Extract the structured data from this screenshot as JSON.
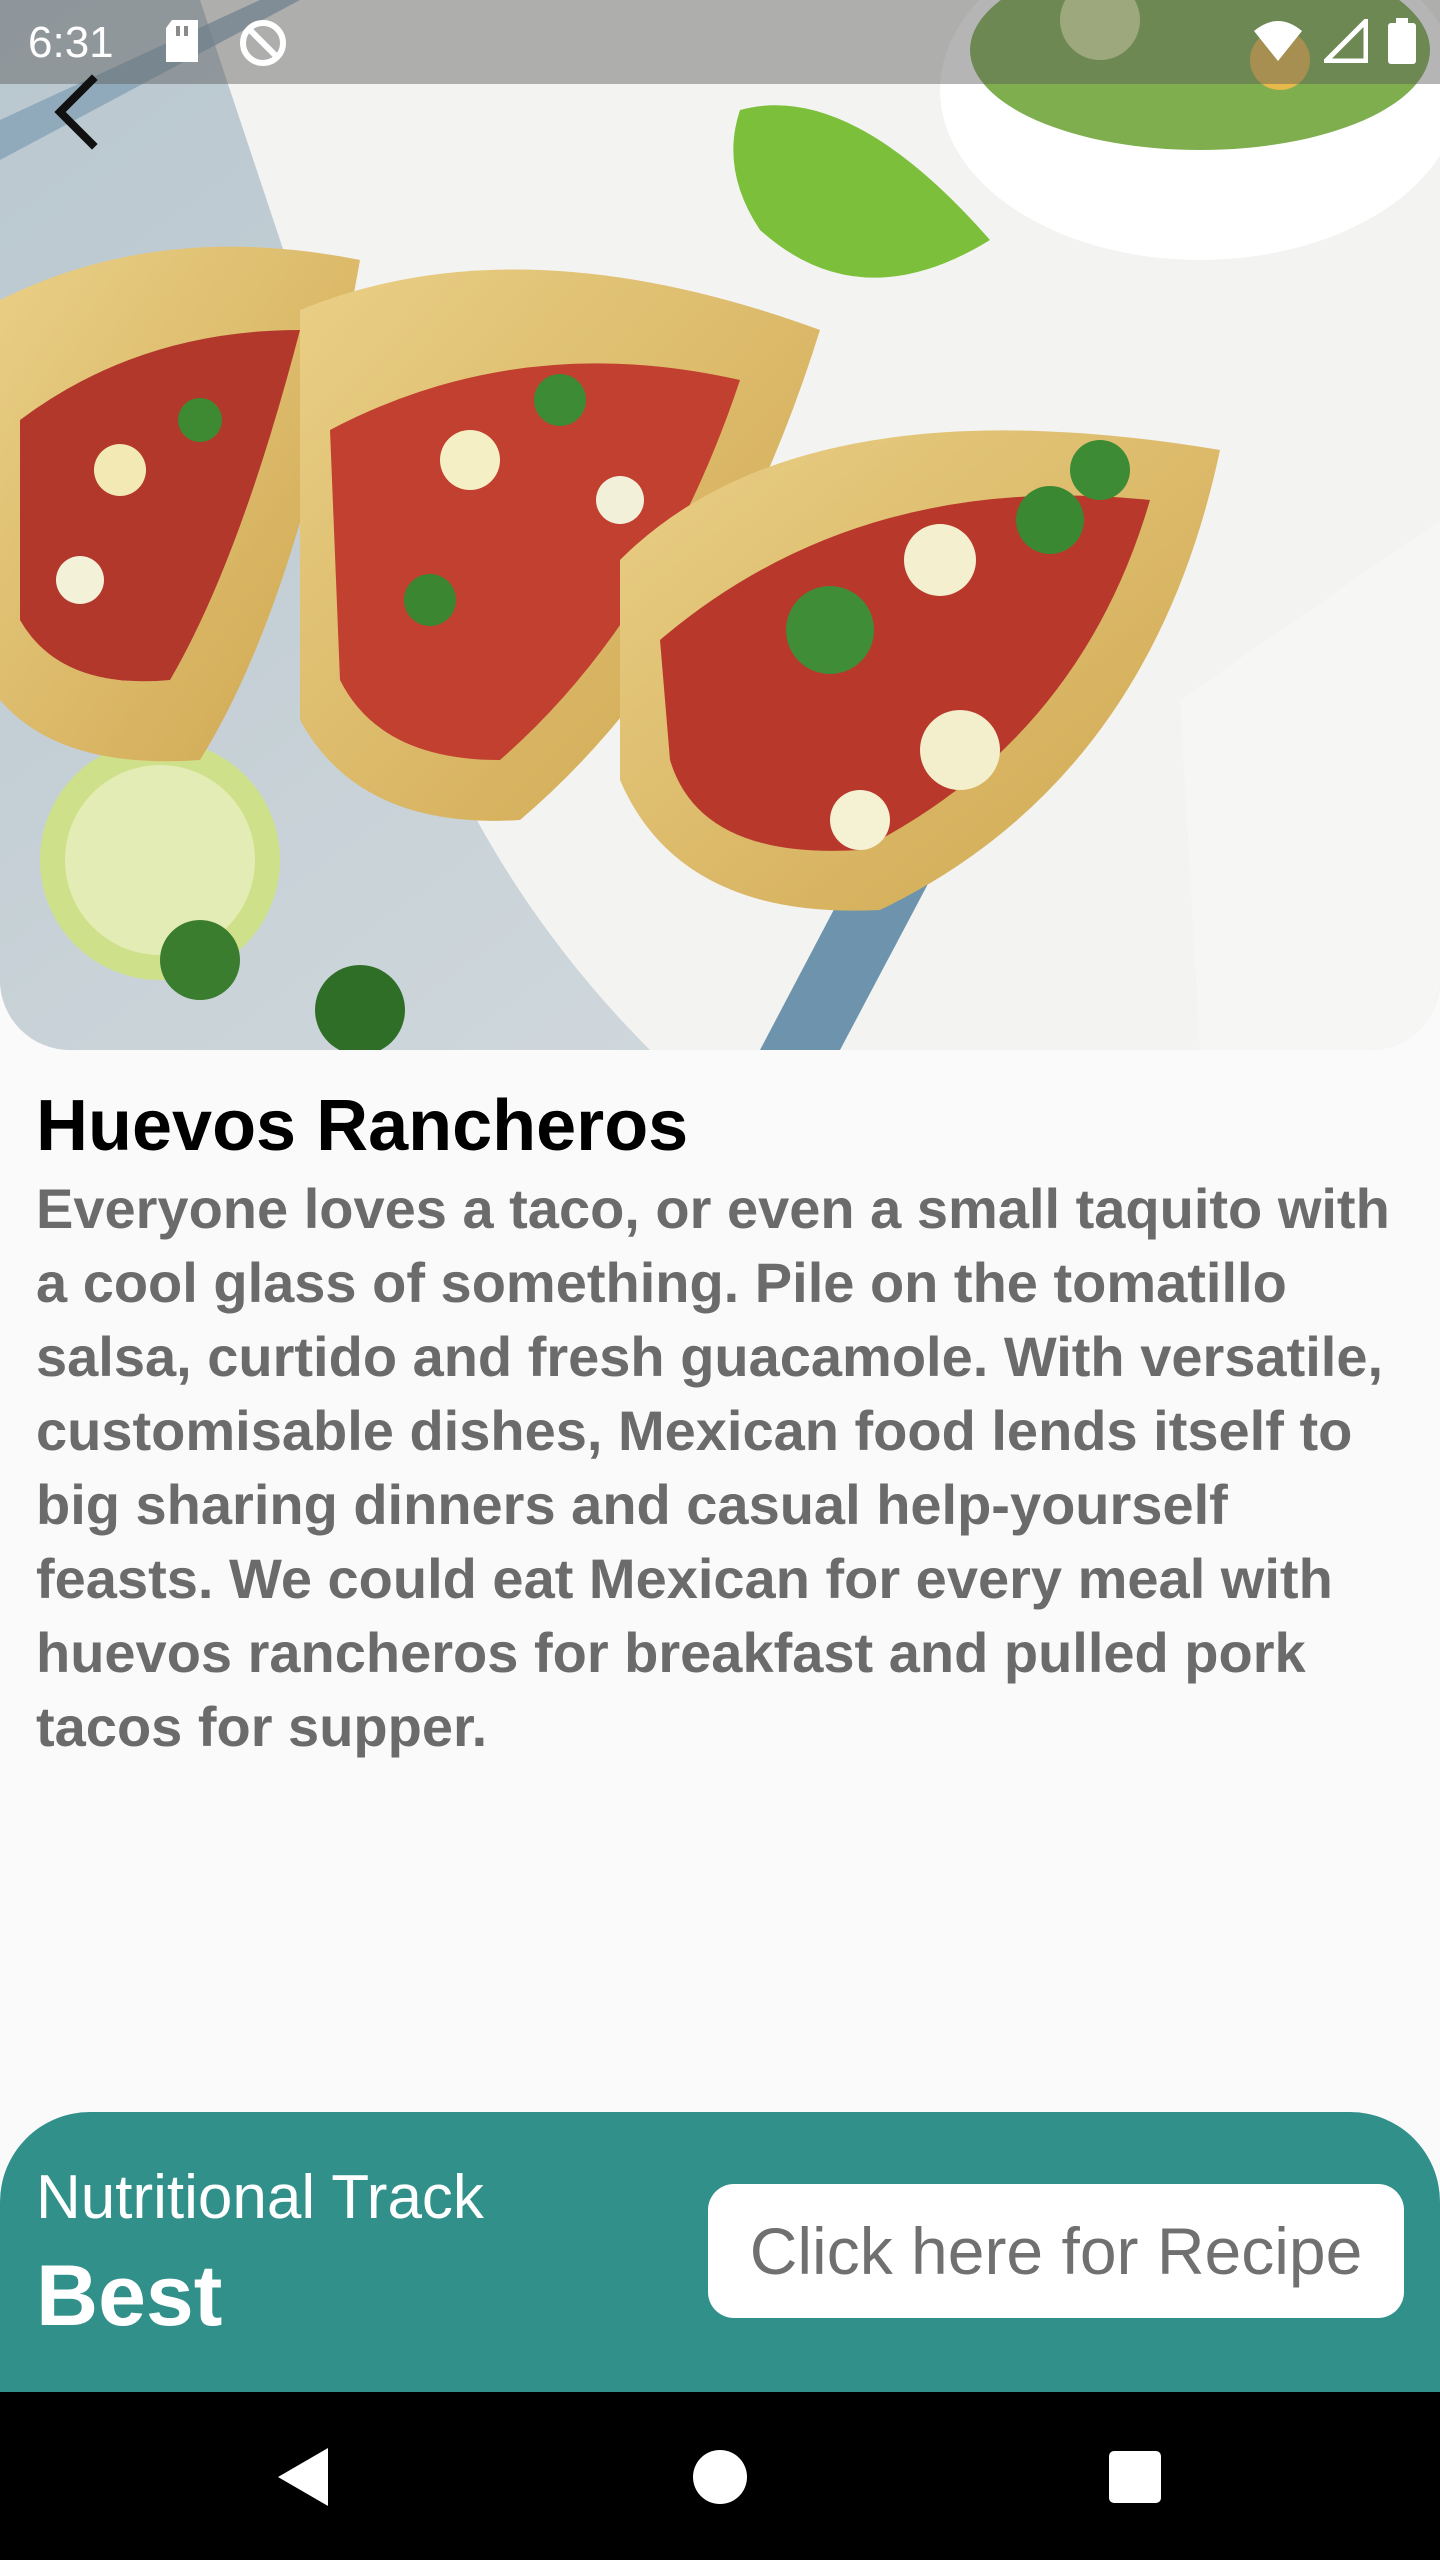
{
  "status_bar": {
    "time": "6:31",
    "icons_left": [
      "sd-card-icon",
      "do-not-disturb-icon"
    ],
    "icons_right": [
      "wifi-icon",
      "signal-icon",
      "battery-icon"
    ]
  },
  "header": {
    "back_icon": "chevron-left-icon",
    "hero_image": "tacos-photo"
  },
  "recipe": {
    "title": "Huevos Rancheros",
    "description": "Everyone loves a taco, or even a small taquito with a cool glass of something. Pile on the tomatillo salsa, curtido and fresh guacamole. With versatile, customisable dishes, Mexican food lends itself to big sharing dinners and casual help-yourself feasts. We could eat Mexican for every meal with huevos rancheros for breakfast and pulled pork tacos for supper."
  },
  "bottom_panel": {
    "label": "Nutritional Track",
    "value": "Best",
    "button_label": "Click here for Recipe",
    "accent_color": "#31918a"
  },
  "nav_bar": {
    "buttons": [
      "back-triangle-icon",
      "home-circle-icon",
      "recents-square-icon"
    ]
  }
}
